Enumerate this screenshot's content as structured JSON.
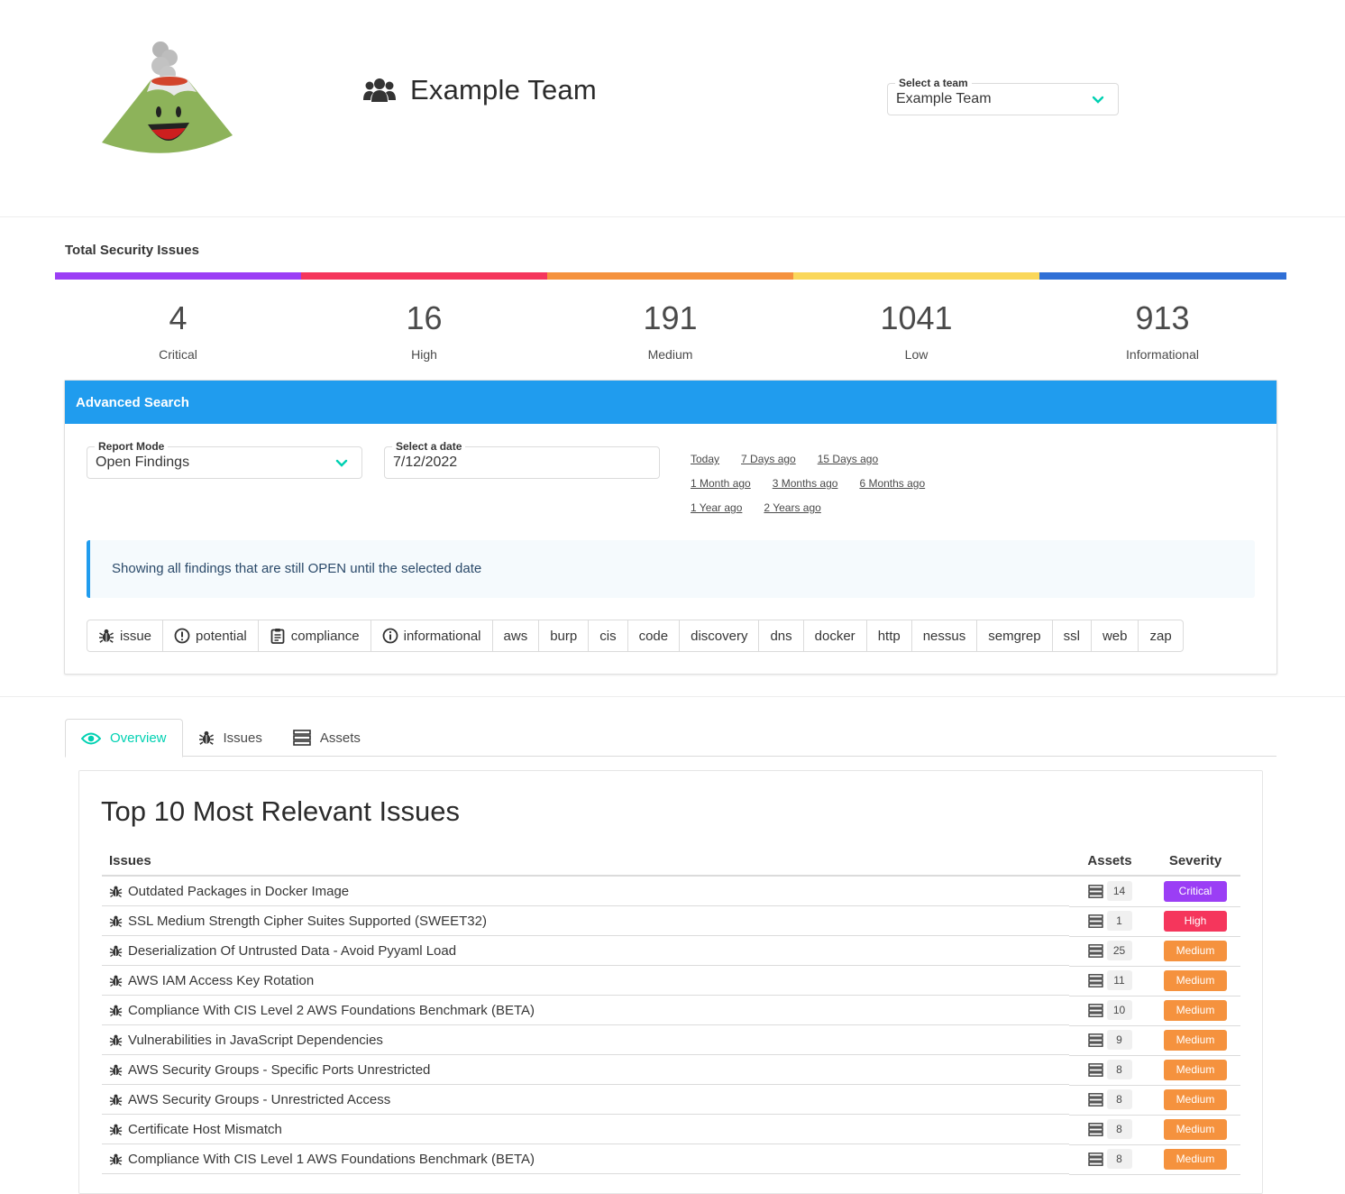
{
  "header": {
    "team_name": "Example Team",
    "team_select": {
      "label": "Select a team",
      "value": "Example Team"
    }
  },
  "totals": {
    "title": "Total Security Issues",
    "items": [
      {
        "count": "4",
        "label": "Critical",
        "color": "#9b3ef5"
      },
      {
        "count": "16",
        "label": "High",
        "color": "#f5365c"
      },
      {
        "count": "191",
        "label": "Medium",
        "color": "#f5923e"
      },
      {
        "count": "1041",
        "label": "Low",
        "color": "#fad75a"
      },
      {
        "count": "913",
        "label": "Informational",
        "color": "#2f6fd6"
      }
    ]
  },
  "advanced_search": {
    "title": "Advanced Search",
    "report_mode": {
      "label": "Report Mode",
      "value": "Open Findings"
    },
    "date": {
      "label": "Select a date",
      "value": "7/12/2022"
    },
    "date_links": [
      [
        "Today",
        "7 Days ago",
        "15 Days ago"
      ],
      [
        "1 Month ago",
        "3 Months ago",
        "6 Months ago"
      ],
      [
        "1 Year ago",
        "2 Years ago"
      ]
    ],
    "notice": "Showing all findings that are still OPEN until the selected date",
    "tags": [
      {
        "label": "issue",
        "icon": "bug-icon"
      },
      {
        "label": "potential",
        "icon": "exclamation-circle-icon"
      },
      {
        "label": "compliance",
        "icon": "clipboard-icon"
      },
      {
        "label": "informational",
        "icon": "info-circle-icon"
      },
      {
        "label": "aws"
      },
      {
        "label": "burp"
      },
      {
        "label": "cis"
      },
      {
        "label": "code"
      },
      {
        "label": "discovery"
      },
      {
        "label": "dns"
      },
      {
        "label": "docker"
      },
      {
        "label": "http"
      },
      {
        "label": "nessus"
      },
      {
        "label": "semgrep"
      },
      {
        "label": "ssl"
      },
      {
        "label": "web"
      },
      {
        "label": "zap"
      }
    ]
  },
  "tabs": [
    {
      "label": "Overview",
      "icon": "eye-icon",
      "active": true
    },
    {
      "label": "Issues",
      "icon": "bug-icon"
    },
    {
      "label": "Assets",
      "icon": "server-icon"
    }
  ],
  "top_issues": {
    "title": "Top 10 Most Relevant Issues",
    "columns": [
      "Issues",
      "Assets",
      "Severity"
    ],
    "rows": [
      {
        "issue": "Outdated Packages in Docker Image",
        "assets": "14",
        "severity": "Critical"
      },
      {
        "issue": "SSL Medium Strength Cipher Suites Supported (SWEET32)",
        "assets": "1",
        "severity": "High"
      },
      {
        "issue": "Deserialization Of Untrusted Data - Avoid Pyyaml Load",
        "assets": "25",
        "severity": "Medium"
      },
      {
        "issue": "AWS IAM Access Key Rotation",
        "assets": "11",
        "severity": "Medium"
      },
      {
        "issue": "Compliance With CIS Level 2 AWS Foundations Benchmark (BETA)",
        "assets": "10",
        "severity": "Medium"
      },
      {
        "issue": "Vulnerabilities in JavaScript Dependencies",
        "assets": "9",
        "severity": "Medium"
      },
      {
        "issue": "AWS Security Groups - Specific Ports Unrestricted",
        "assets": "8",
        "severity": "Medium"
      },
      {
        "issue": "AWS Security Groups - Unrestricted Access",
        "assets": "8",
        "severity": "Medium"
      },
      {
        "issue": "Certificate Host Mismatch",
        "assets": "8",
        "severity": "Medium"
      },
      {
        "issue": "Compliance With CIS Level 1 AWS Foundations Benchmark (BETA)",
        "assets": "8",
        "severity": "Medium"
      }
    ],
    "severity_colors": {
      "Critical": "#9b3ef5",
      "High": "#f5365c",
      "Medium": "#f5923e"
    }
  }
}
